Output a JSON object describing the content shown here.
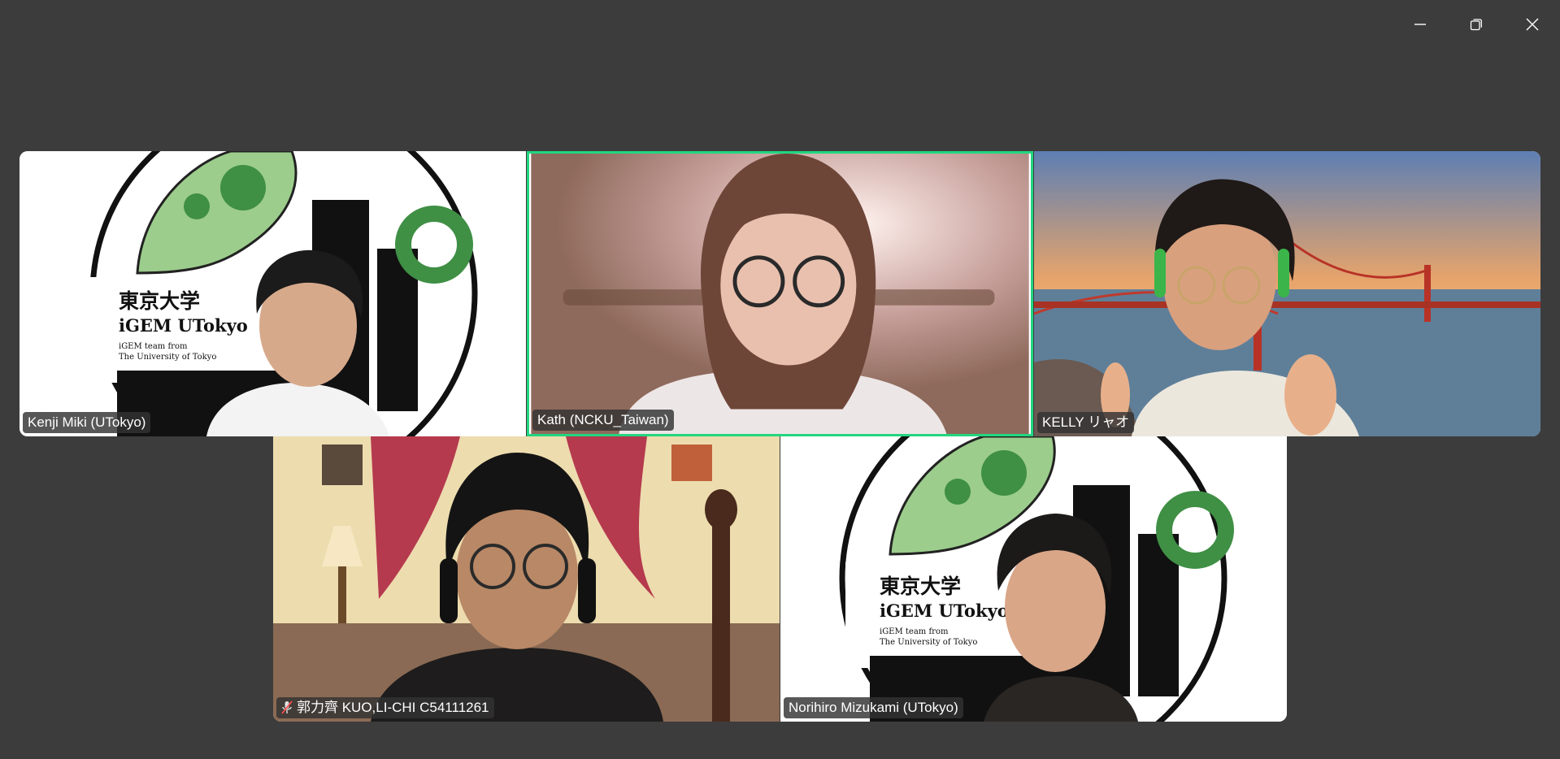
{
  "window_controls": {
    "minimize": "minimize-icon",
    "restore": "restore-icon",
    "close": "close-icon"
  },
  "colors": {
    "background": "#3c3c3c",
    "active_speaker_border": "#22d67f",
    "logo_green": "#3f8f45",
    "logo_light_green": "#9ccd8c"
  },
  "participants": [
    {
      "name": "Kenji Miki (UTokyo)",
      "muted": false,
      "background": "iGEM UTokyo logo",
      "speaking": false,
      "logo": {
        "line1": "東京大学",
        "line2": "iGEM UTokyo",
        "line3": "iGEM team from",
        "line4": "The University of Tokyo"
      }
    },
    {
      "name": "Kath (NCKU_Taiwan)",
      "muted": false,
      "background": "room",
      "speaking": true
    },
    {
      "name": "KELLY リャオ",
      "muted": false,
      "background": "golden gate bridge",
      "speaking": false
    },
    {
      "name": "郭力齊 KUO,LI-CHI C54111261",
      "muted": true,
      "background": "bedroom",
      "speaking": false
    },
    {
      "name": "Norihiro Mizukami (UTokyo)",
      "muted": false,
      "background": "iGEM UTokyo logo",
      "speaking": false,
      "logo": {
        "line1": "東京大学",
        "line2": "iGEM UTokyo",
        "line3": "iGEM team from",
        "line4": "The University of Tokyo"
      }
    }
  ]
}
